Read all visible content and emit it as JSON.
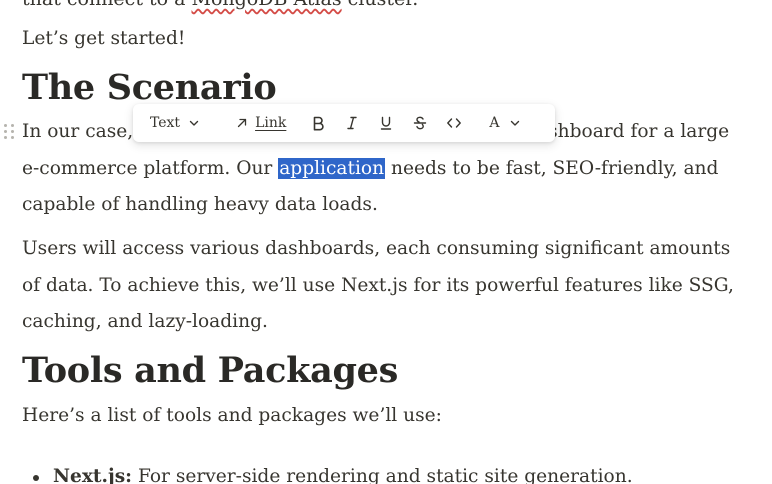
{
  "document": {
    "cut_line": {
      "prefix": "that connect to a ",
      "misspelled": "MongoDB Atlas",
      "suffix": " cluster."
    },
    "intro": "Let’s get started!",
    "heading_scenario": "The Scenario",
    "scenario_line1_start": "In our case, ",
    "scenario_line1_end": "shboard for a large",
    "scenario_line2_before": "e-commerce platform. Our ",
    "scenario_selected_word": "application",
    "scenario_line2_after": " needs to be fast, SEO-friendly, and",
    "scenario_line3": "capable of handling heavy data loads.",
    "users_line1": "Users will access various dashboards, each consuming significant amounts",
    "users_line2": "of data. To achieve this, we’ll use Next.js for its powerful features like SSG,",
    "users_line3": "caching, and lazy-loading.",
    "heading_tools": "Tools and Packages",
    "tools_intro": "Here’s a list of tools and packages we’ll use:",
    "bullets": [
      {
        "term": "Next.js:",
        "desc": " For server-side rendering and static site generation."
      }
    ]
  },
  "toolbar": {
    "block_type_label": "Text",
    "link_label": "Link",
    "color_label": "A",
    "icons": {
      "block_type_chevron": "chevron-down-icon",
      "link": "arrow-up-right-icon",
      "bold": "bold-icon",
      "italic": "italic-icon",
      "underline": "underline-icon",
      "strikethrough": "strikethrough-icon",
      "code": "code-icon",
      "color_chevron": "chevron-down-icon"
    }
  },
  "colors": {
    "text": "#37352f",
    "selection": "#2f66c9",
    "spellcheck": "#d44c47"
  }
}
